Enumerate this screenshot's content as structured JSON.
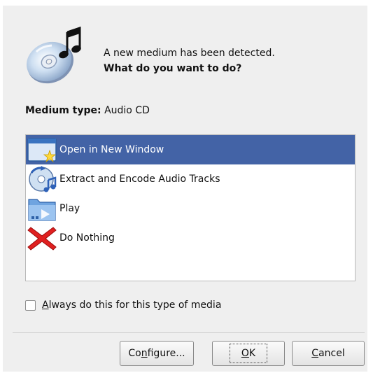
{
  "dialog": {
    "message_line1": "A new medium has been detected.",
    "message_line2": "What do you want to do?",
    "medium_type_label": "Medium type:",
    "medium_type_value": "Audio CD"
  },
  "actions": [
    {
      "label": "Open in New Window",
      "icon": "open-window-icon",
      "selected": true
    },
    {
      "label": "Extract and Encode Audio Tracks",
      "icon": "audio-extract-icon",
      "selected": false
    },
    {
      "label": "Play",
      "icon": "play-folder-icon",
      "selected": false
    },
    {
      "label": "Do Nothing",
      "icon": "red-x-icon",
      "selected": false
    }
  ],
  "always_checkbox": {
    "label_mnemonic": "A",
    "label_rest": "lways do this for this type of media",
    "checked": false
  },
  "buttons": {
    "configure_pre": "Co",
    "configure_mnemonic": "n",
    "configure_post": "figure...",
    "ok_mnemonic": "O",
    "ok_post": "K",
    "cancel_mnemonic": "C",
    "cancel_post": "ancel"
  },
  "colors": {
    "selection": "#4363a6",
    "dialog_bg": "#efefef"
  }
}
